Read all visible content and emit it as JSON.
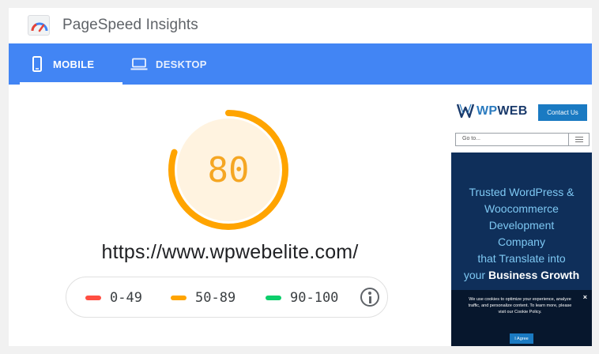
{
  "app": {
    "title": "PageSpeed Insights",
    "logo_icon": "pagespeed-logo-icon"
  },
  "tabs": [
    {
      "label": "MOBILE",
      "icon": "phone-icon",
      "active": true
    },
    {
      "label": "DESKTOP",
      "icon": "laptop-icon",
      "active": false
    }
  ],
  "colors": {
    "tab_bar": "#4285f4",
    "score_average": "#ffa400",
    "score_poor": "#ff4e42",
    "score_good": "#0cce6b"
  },
  "score": {
    "value": "80",
    "fraction": 0.8,
    "url": "https://www.wpwebelite.com/"
  },
  "legend": [
    {
      "label": "0-49",
      "color": "#ff4e42"
    },
    {
      "label": "50-89",
      "color": "#ffa400"
    },
    {
      "label": "90-100",
      "color": "#0cce6b"
    }
  ],
  "preview": {
    "logo_text_a": "WP",
    "logo_text_b": "WEB",
    "contact_label": "Contact Us",
    "goto_placeholder": "Go to...",
    "hero_lines": [
      "Trusted WordPress &",
      "Woocommerce",
      "Development",
      "Company",
      "that Translate into"
    ],
    "hero_last_a": "your ",
    "hero_last_b": "Business Growth",
    "cookie_text": "We use cookies to optimize your experience, analyze traffic, and personalize content. To learn more, please visit our Cookie Policy.",
    "cookie_close": "×",
    "cookie_agree": "I Agree"
  }
}
